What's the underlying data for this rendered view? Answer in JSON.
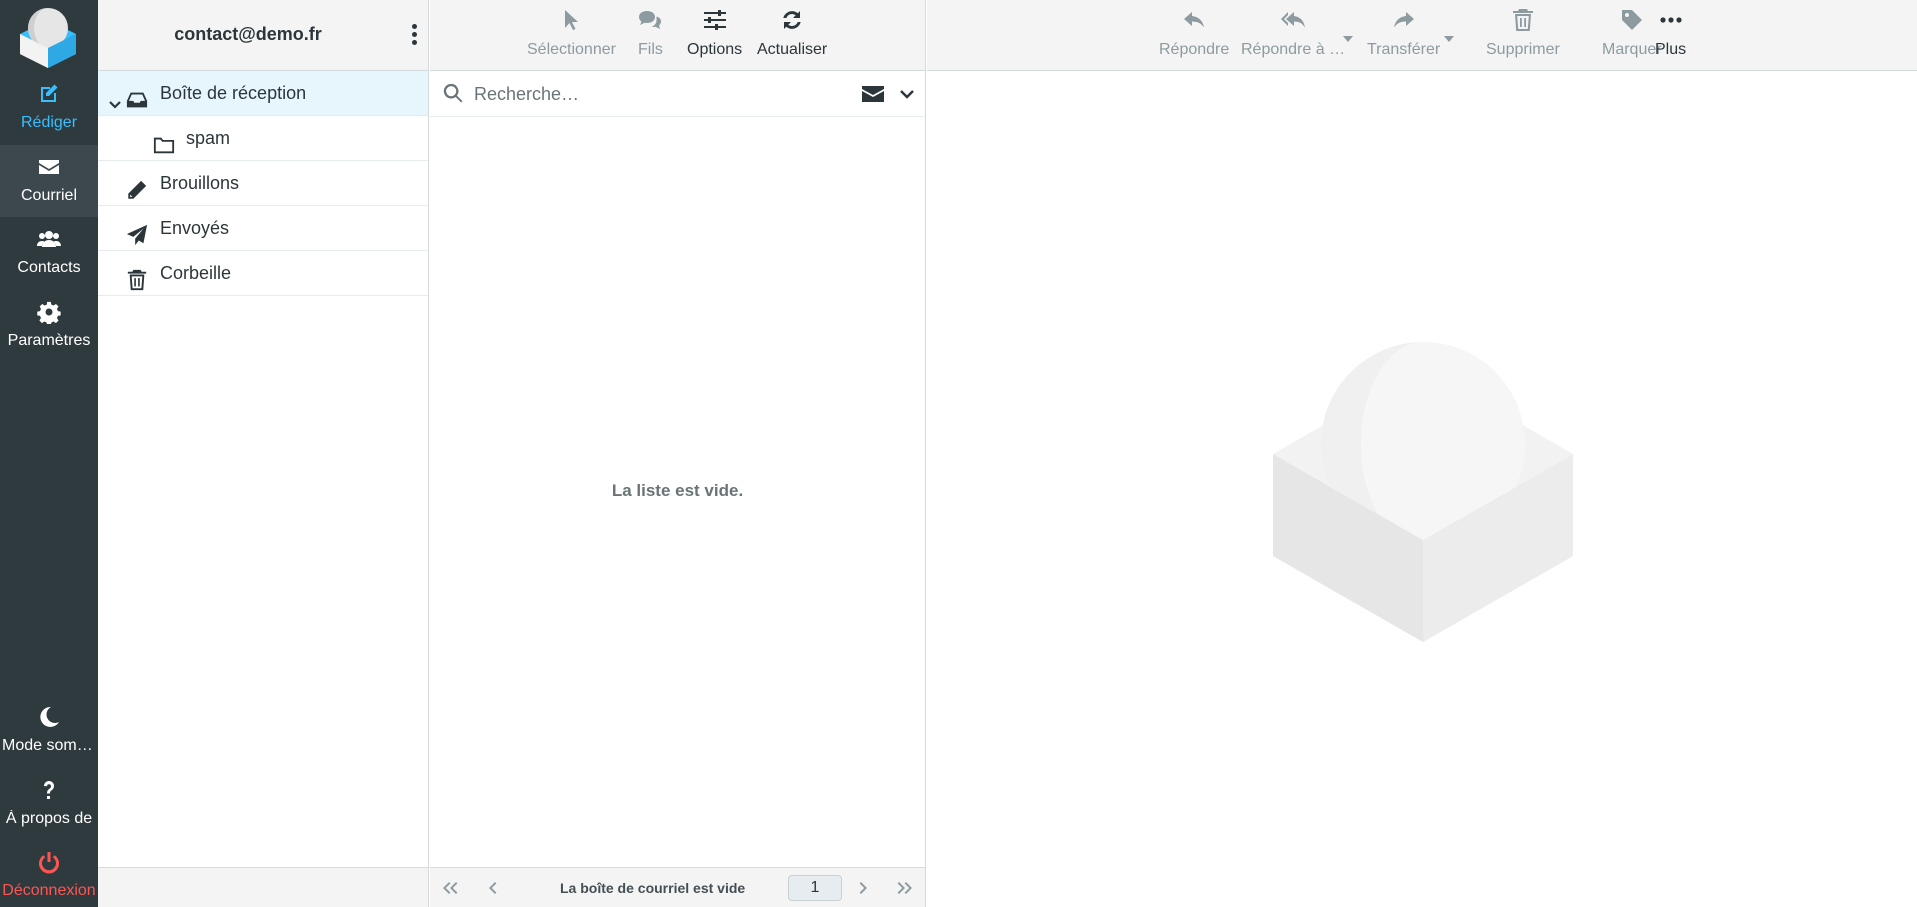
{
  "nav": {
    "compose": "Rédiger",
    "mail": "Courriel",
    "contacts": "Contacts",
    "settings": "Paramètres",
    "dark_mode": "Mode sombre",
    "about": "À propos de",
    "logout": "Déconnexion"
  },
  "folders": {
    "account": "contact@demo.fr",
    "items": [
      {
        "label": "Boîte de réception",
        "icon": "inbox-icon",
        "selected": true
      },
      {
        "label": "spam",
        "icon": "folder-icon"
      },
      {
        "label": "Brouillons",
        "icon": "pencil-icon"
      },
      {
        "label": "Envoyés",
        "icon": "paper-plane-icon"
      },
      {
        "label": "Corbeille",
        "icon": "trash-icon"
      }
    ]
  },
  "list": {
    "toolbar": {
      "select": "Sélectionner",
      "threads": "Fils",
      "options": "Options",
      "refresh": "Actualiser"
    },
    "search_placeholder": "Recherche…",
    "empty_message": "La liste est vide.",
    "footer_text": "La boîte de courriel est vide",
    "page": "1"
  },
  "content": {
    "toolbar": {
      "reply": "Répondre",
      "reply_all": "Répondre à …",
      "forward": "Transférer",
      "delete": "Supprimer",
      "mark": "Marquer",
      "more": "Plus"
    }
  },
  "colors": {
    "nav_bg": "#2f3a3f",
    "accent": "#37beff",
    "logout": "#ff5552",
    "selected_row": "#e6f6fc"
  }
}
